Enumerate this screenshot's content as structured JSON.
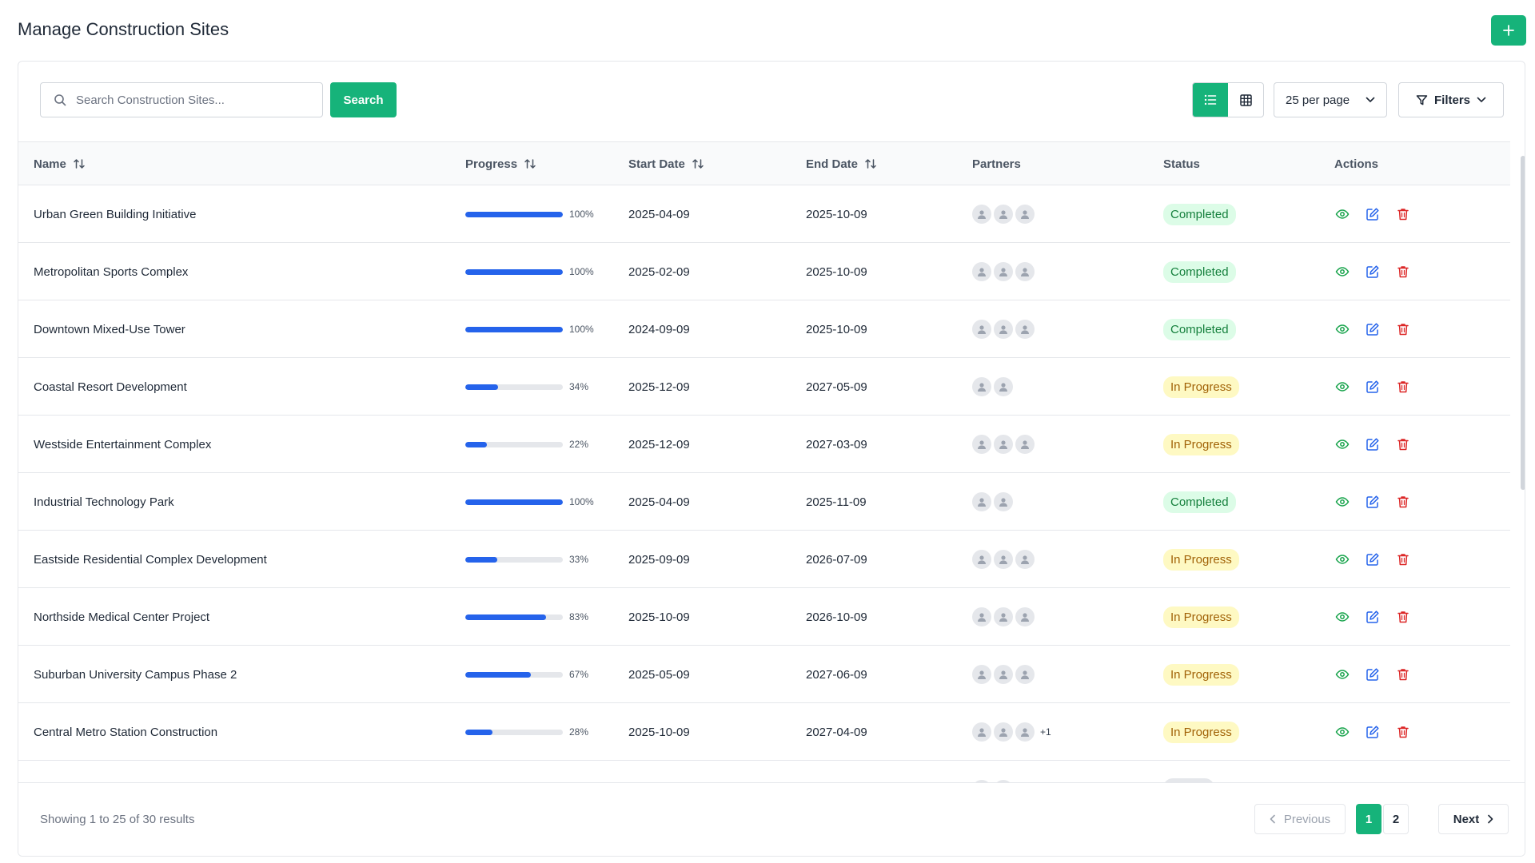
{
  "header": {
    "title": "Manage Construction Sites",
    "add_icon": "plus-icon"
  },
  "toolbar": {
    "search_placeholder": "Search Construction Sites...",
    "search_label": "Search",
    "per_page": "25 per page",
    "filters_label": "Filters"
  },
  "columns": {
    "name": "Name",
    "progress": "Progress",
    "start": "Start Date",
    "end": "End Date",
    "partners": "Partners",
    "status": "Status",
    "actions": "Actions"
  },
  "rows": [
    {
      "name": "Urban Green Building Initiative",
      "progress": 100,
      "progress_label": "100%",
      "start": "2025-04-09",
      "end": "2025-10-09",
      "partners": 3,
      "more": "",
      "status": "Completed",
      "status_type": "completed"
    },
    {
      "name": "Metropolitan Sports Complex",
      "progress": 100,
      "progress_label": "100%",
      "start": "2025-02-09",
      "end": "2025-10-09",
      "partners": 3,
      "more": "",
      "status": "Completed",
      "status_type": "completed"
    },
    {
      "name": "Downtown Mixed-Use Tower",
      "progress": 100,
      "progress_label": "100%",
      "start": "2024-09-09",
      "end": "2025-10-09",
      "partners": 3,
      "more": "",
      "status": "Completed",
      "status_type": "completed"
    },
    {
      "name": "Coastal Resort Development",
      "progress": 34,
      "progress_label": "34%",
      "start": "2025-12-09",
      "end": "2027-05-09",
      "partners": 2,
      "more": "",
      "status": "In Progress",
      "status_type": "progress"
    },
    {
      "name": "Westside Entertainment Complex",
      "progress": 22,
      "progress_label": "22%",
      "start": "2025-12-09",
      "end": "2027-03-09",
      "partners": 3,
      "more": "",
      "status": "In Progress",
      "status_type": "progress"
    },
    {
      "name": "Industrial Technology Park",
      "progress": 100,
      "progress_label": "100%",
      "start": "2025-04-09",
      "end": "2025-11-09",
      "partners": 2,
      "more": "",
      "status": "Completed",
      "status_type": "completed"
    },
    {
      "name": "Eastside Residential Complex Development",
      "progress": 33,
      "progress_label": "33%",
      "start": "2025-09-09",
      "end": "2026-07-09",
      "partners": 3,
      "more": "",
      "status": "In Progress",
      "status_type": "progress"
    },
    {
      "name": "Northside Medical Center Project",
      "progress": 83,
      "progress_label": "83%",
      "start": "2025-10-09",
      "end": "2026-10-09",
      "partners": 3,
      "more": "",
      "status": "In Progress",
      "status_type": "progress"
    },
    {
      "name": "Suburban University Campus Phase 2",
      "progress": 67,
      "progress_label": "67%",
      "start": "2025-05-09",
      "end": "2027-06-09",
      "partners": 3,
      "more": "",
      "status": "In Progress",
      "status_type": "progress"
    },
    {
      "name": "Central Metro Station Construction",
      "progress": 28,
      "progress_label": "28%",
      "start": "2025-10-09",
      "end": "2027-04-09",
      "partners": 3,
      "more": "+1",
      "status": "In Progress",
      "status_type": "progress"
    },
    {
      "name": "",
      "progress": 0,
      "progress_label": "",
      "start": "",
      "end": "",
      "partners": 2,
      "more": "",
      "status": "",
      "status_type": "planned"
    }
  ],
  "footer": {
    "showing": "Showing 1 to 25 of 30 results",
    "previous": "Previous",
    "page1": "1",
    "page2": "2",
    "next": "Next"
  },
  "colors": {
    "accent": "#16b37a",
    "progress": "#2563eb",
    "view": "#16a34a",
    "edit": "#2563eb",
    "delete": "#dc2626"
  }
}
